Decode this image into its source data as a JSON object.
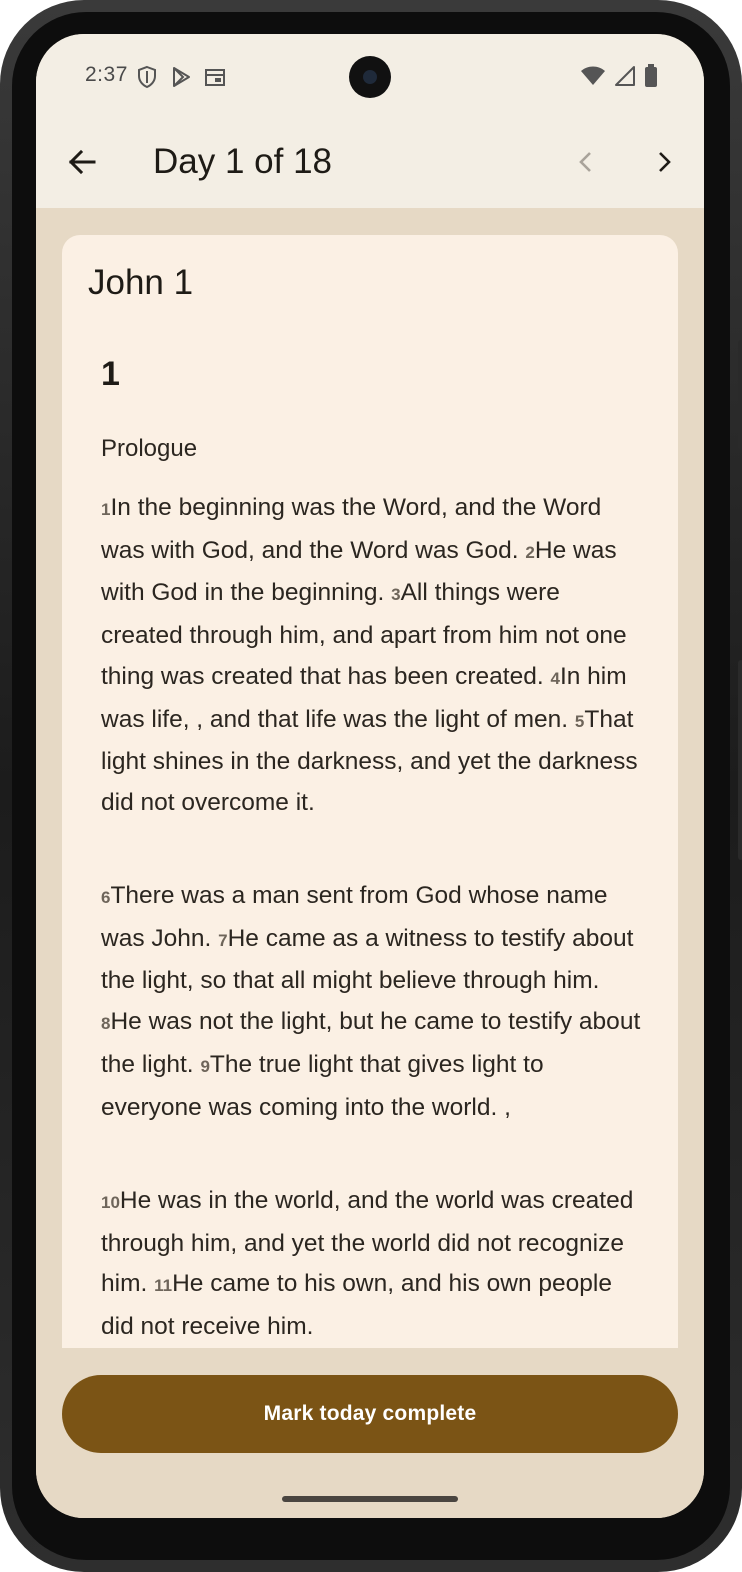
{
  "status_bar": {
    "time": "2:37",
    "left_icons": [
      "shield-icon",
      "play-store-icon",
      "calendar-icon"
    ],
    "right_icons": [
      "wifi-icon",
      "cell-signal-icon",
      "battery-icon"
    ]
  },
  "app_bar": {
    "title": "Day 1 of 18",
    "back_icon": "arrow-back-icon",
    "prev_icon": "chevron-left-icon",
    "next_icon": "chevron-right-icon",
    "prev_enabled": false
  },
  "reading": {
    "passage_reference": "John 1",
    "chapter_number": "1",
    "section_heading": "Prologue",
    "paragraphs": [
      [
        {
          "num": "1",
          "text": "In the beginning  was the Word,  and the Word was with God, and the Word was God. "
        },
        {
          "num": "2",
          "text": "He was with God in the beginning.  "
        },
        {
          "num": "3",
          "text": "All things were created  through him,  and apart from him not one thing was created that has been created. "
        },
        {
          "num": "4",
          "text": "In him was life, , and that life was the light  of men. "
        },
        {
          "num": "5",
          "text": "That light shines  in the darkness, and yet the darkness did not overcome  it."
        }
      ],
      [
        {
          "num": "6",
          "text": "There was a man sent from God whose name was John.  "
        },
        {
          "num": "7",
          "text": "He came as a witness to testify about the light, so that all might believe through him.  "
        },
        {
          "num": "8",
          "text": "He was not the light, but he came to testify  about the light. "
        },
        {
          "num": "9",
          "text": "The true light  that gives light to everyone was coming into the world. ,"
        }
      ],
      [
        {
          "num": "10",
          "text": "He was in the world, and the world was created  through him, and yet the world did not recognize him. "
        },
        {
          "num": "11",
          "text": "He came to his own, and his own people did not receive him."
        }
      ]
    ]
  },
  "actions": {
    "mark_complete_label": "Mark today complete"
  },
  "colors": {
    "accent": "#7b5415",
    "card_background": "#fbf0e4",
    "page_background": "#e6d9c5",
    "app_bar_background": "#f3eee4"
  }
}
